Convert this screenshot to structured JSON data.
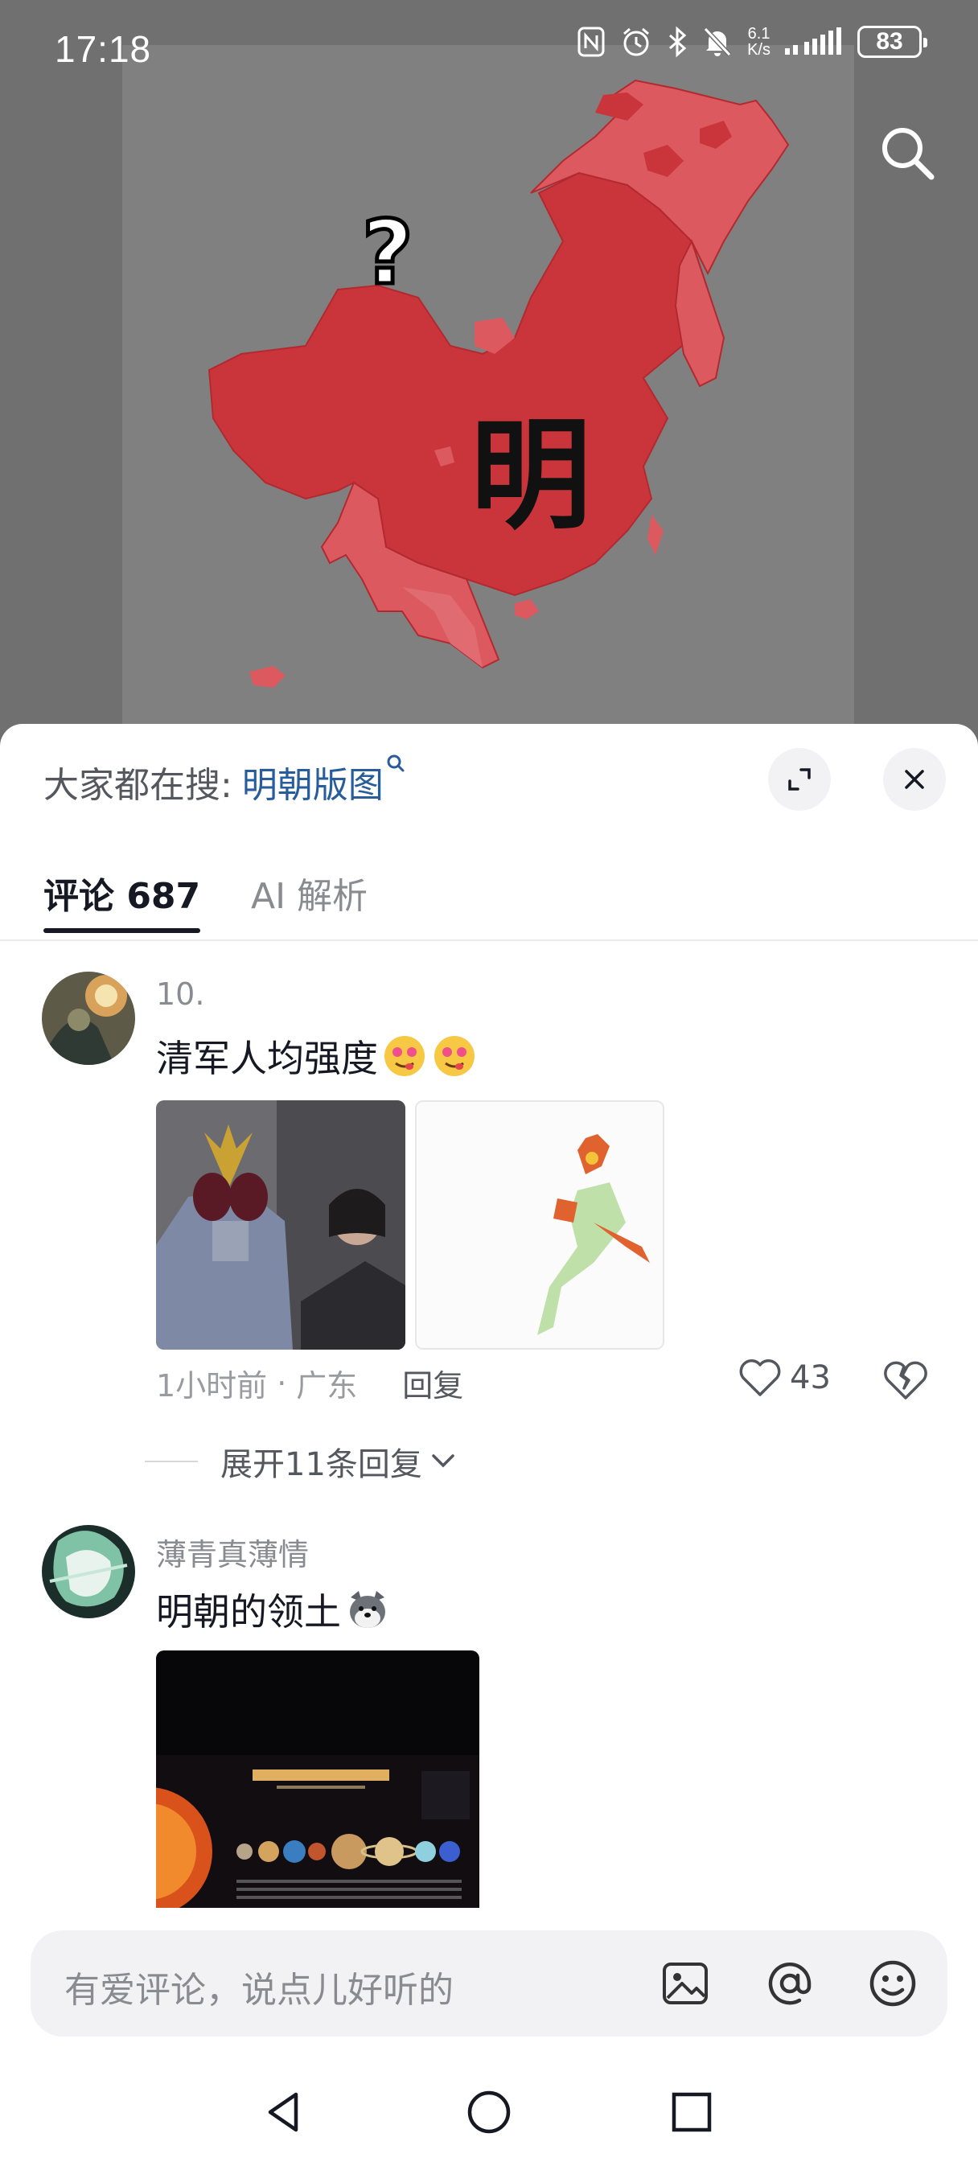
{
  "status_bar": {
    "time": "17:18",
    "net_speed_value": "6.1",
    "net_speed_unit": "K/s",
    "battery": "83"
  },
  "video": {
    "map_question": "?",
    "map_label": "明"
  },
  "panel": {
    "hot_search_prefix": "大家都在搜:",
    "hot_search_keyword": "明朝版图",
    "tabs": [
      {
        "label": "评论 687"
      },
      {
        "label": "AI 解析"
      }
    ]
  },
  "comments": [
    {
      "username": "10.",
      "text": "清军人均强度",
      "time": "1小时前",
      "location": "广东",
      "separator": "·",
      "reply_label": "回复",
      "likes": "43",
      "expand_label": "展开11条回复"
    },
    {
      "username": "薄青真薄情",
      "text": "明朝的领土"
    }
  ],
  "input": {
    "placeholder": "有爱评论，说点儿好听的"
  },
  "colors": {
    "map_red": "#c9353a",
    "map_light_red": "#dc5a5f",
    "link_blue": "#275d9a"
  },
  "icons": [
    "search-icon",
    "expand-icon",
    "close-icon",
    "heart-icon",
    "broken-heart-icon",
    "chevron-down-icon",
    "image-icon",
    "at-icon",
    "emoji-icon",
    "back-icon",
    "home-icon",
    "recents-icon"
  ]
}
